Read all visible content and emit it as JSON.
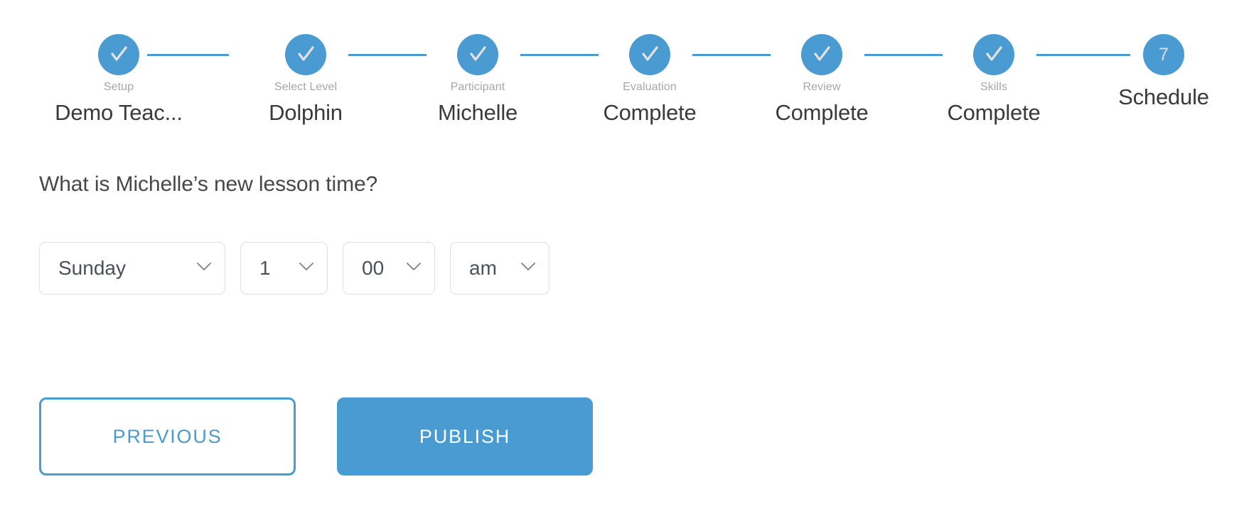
{
  "theme": {
    "accent": "#4a9bd1",
    "text_dark": "#3a3a3a",
    "text_muted": "#a7a7a7",
    "field_border": "#dde1e5",
    "field_text": "#4a5159"
  },
  "stepper": {
    "steps": [
      {
        "index": "1",
        "label": "Setup",
        "value": "Demo Teac...",
        "state": "complete",
        "icon": "check-icon"
      },
      {
        "index": "2",
        "label": "Select Level",
        "value": "Dolphin",
        "state": "complete",
        "icon": "check-icon"
      },
      {
        "index": "3",
        "label": "Participant",
        "value": "Michelle",
        "state": "complete",
        "icon": "check-icon"
      },
      {
        "index": "4",
        "label": "Evaluation",
        "value": "Complete",
        "state": "complete",
        "icon": "check-icon"
      },
      {
        "index": "5",
        "label": "Review",
        "value": "Complete",
        "state": "complete",
        "icon": "check-icon"
      },
      {
        "index": "6",
        "label": "Skills",
        "value": "Complete",
        "state": "complete",
        "icon": "check-icon"
      },
      {
        "index": "7",
        "label": "",
        "value": "Schedule",
        "state": "current",
        "icon": ""
      }
    ]
  },
  "main": {
    "question": "What is Michelle’s new lesson time?",
    "fields": {
      "day": {
        "name": "day-select",
        "value": "Sunday",
        "caret": "chevron-down-icon"
      },
      "hour": {
        "name": "hour-select",
        "value": "1",
        "caret": "chevron-down-icon"
      },
      "minute": {
        "name": "minute-select",
        "value": "00",
        "caret": "chevron-down-icon"
      },
      "meridiem": {
        "name": "meridiem-select",
        "value": "am",
        "caret": "chevron-down-icon"
      }
    }
  },
  "footer": {
    "previous_label": "PREVIOUS",
    "publish_label": "PUBLISH"
  }
}
